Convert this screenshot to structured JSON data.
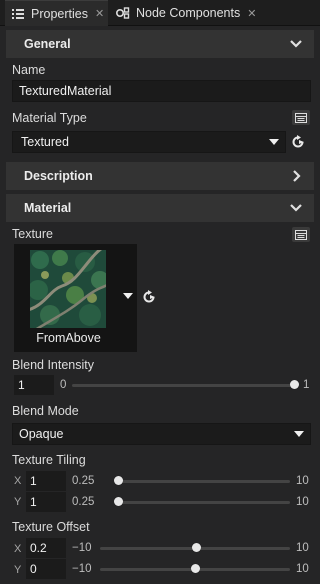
{
  "tabs": [
    {
      "label": "Properties",
      "icon": "list-icon",
      "active": true
    },
    {
      "label": "Node Components",
      "icon": "components-icon",
      "active": false
    }
  ],
  "sections": {
    "general": "General",
    "description": "Description",
    "material": "Material"
  },
  "name": {
    "label": "Name",
    "value": "TexturedMaterial"
  },
  "material_type": {
    "label": "Material Type",
    "value": "Textured"
  },
  "texture": {
    "label": "Texture",
    "value": "FromAbove"
  },
  "blend_intensity": {
    "label": "Blend Intensity",
    "value": "1",
    "min": "0",
    "max": "1",
    "level": 1.0
  },
  "blend_mode": {
    "label": "Blend Mode",
    "value": "Opaque"
  },
  "texture_tiling": {
    "label": "Texture Tiling",
    "x": {
      "axis": "X",
      "value": "1",
      "min": "0.25",
      "max": "10",
      "level": 0.0
    },
    "y": {
      "axis": "Y",
      "value": "1",
      "min": "0.25",
      "max": "10",
      "level": 0.0
    }
  },
  "texture_offset": {
    "label": "Texture Offset",
    "x": {
      "axis": "X",
      "value": "0.2",
      "min": "−10",
      "max": "10",
      "level": 0.51
    },
    "y": {
      "axis": "Y",
      "value": "0",
      "min": "−10",
      "max": "10",
      "level": 0.5
    }
  },
  "colors": {
    "panel": "#252526",
    "section": "#333333",
    "field": "#1b1b1b"
  }
}
